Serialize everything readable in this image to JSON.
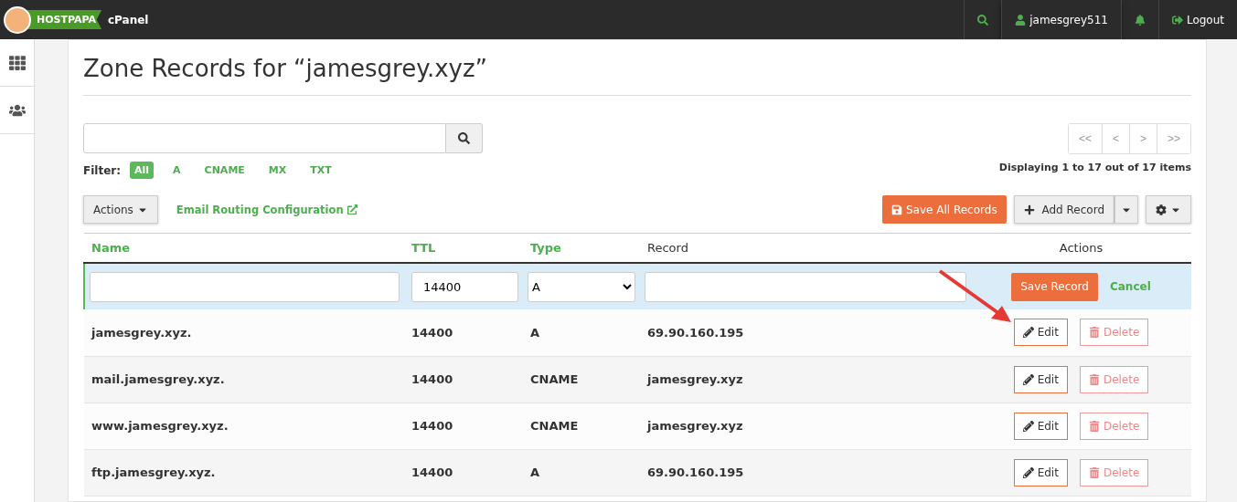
{
  "topbar": {
    "logo": "HOSTPAPA",
    "product": "cPanel",
    "user": "jamesgrey511",
    "logout": "Logout"
  },
  "sidebar": {
    "items": [
      {
        "kind": "grid"
      },
      {
        "kind": "users"
      }
    ]
  },
  "page": {
    "title": "Zone Records for “jamesgrey.xyz”"
  },
  "filter": {
    "label": "Filter:",
    "options": [
      {
        "label": "All",
        "selected": true
      },
      {
        "label": "A",
        "selected": false
      },
      {
        "label": "CNAME",
        "selected": false
      },
      {
        "label": "MX",
        "selected": false
      },
      {
        "label": "TXT",
        "selected": false
      }
    ]
  },
  "pagination": {
    "buttons": [
      "<<",
      "<",
      ">",
      ">>"
    ],
    "summary": "Displaying 1 to 17 out of 17 items"
  },
  "toolbar": {
    "actions": "Actions",
    "email_link": "Email Routing Configuration",
    "save_all": "Save All Records",
    "add_record": "Add Record"
  },
  "table": {
    "columns": [
      {
        "label": "Name",
        "sortable": true
      },
      {
        "label": "TTL",
        "sortable": true
      },
      {
        "label": "Type",
        "sortable": true
      },
      {
        "label": "Record",
        "sortable": false
      },
      {
        "label": "Actions",
        "sortable": false
      }
    ],
    "edit_row": {
      "ttl": "14400",
      "type": "A",
      "save": "Save Record",
      "cancel": "Cancel"
    },
    "rows": [
      {
        "name": "jamesgrey.xyz.",
        "ttl": "14400",
        "type": "A",
        "record": "69.90.160.195",
        "edit": "Edit",
        "delete": "Delete"
      },
      {
        "name": "mail.jamesgrey.xyz.",
        "ttl": "14400",
        "type": "CNAME",
        "record": "jamesgrey.xyz",
        "edit": "Edit",
        "delete": "Delete"
      },
      {
        "name": "www.jamesgrey.xyz.",
        "ttl": "14400",
        "type": "CNAME",
        "record": "jamesgrey.xyz",
        "edit": "Edit",
        "delete": "Delete"
      },
      {
        "name": "ftp.jamesgrey.xyz.",
        "ttl": "14400",
        "type": "A",
        "record": "69.90.160.195",
        "edit": "Edit",
        "delete": "Delete"
      }
    ]
  }
}
